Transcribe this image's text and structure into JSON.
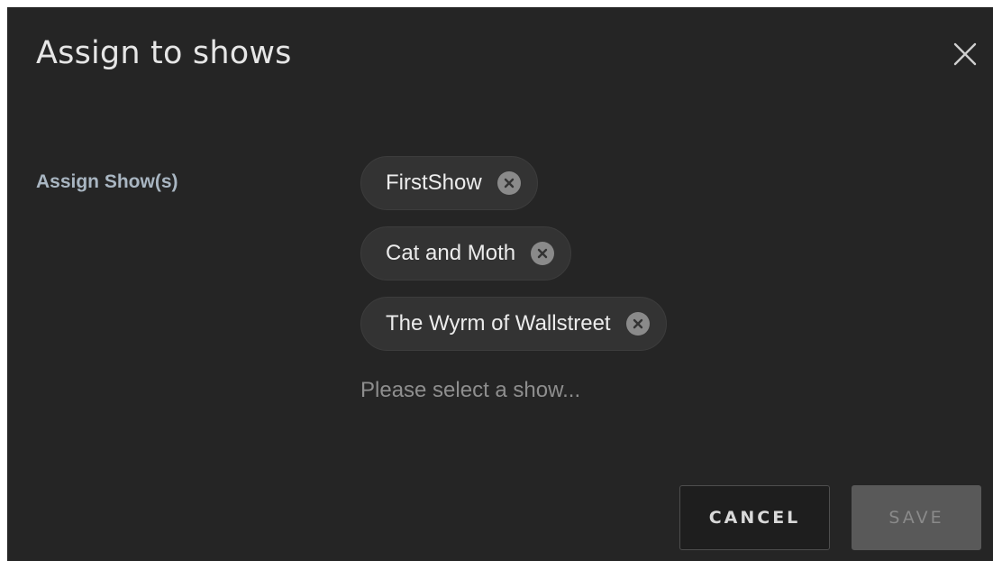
{
  "dialog": {
    "title": "Assign to shows",
    "close_icon": "close-icon",
    "field_label": "Assign Show(s)",
    "selected_shows": [
      {
        "label": "FirstShow",
        "remove_icon": "remove-circle-x-icon"
      },
      {
        "label": "Cat and Moth",
        "remove_icon": "remove-circle-x-icon"
      },
      {
        "label": "The Wyrm of Wallstreet",
        "remove_icon": "remove-circle-x-icon"
      }
    ],
    "select_placeholder": "Please select a show...",
    "select_value": "",
    "buttons": {
      "cancel": "CANCEL",
      "save": "SAVE",
      "save_state": "disabled"
    }
  },
  "colors": {
    "dialog_background": "#252525",
    "chip_background": "#333333",
    "label_color": "#a9b6c2",
    "save_button_background": "#595959"
  }
}
